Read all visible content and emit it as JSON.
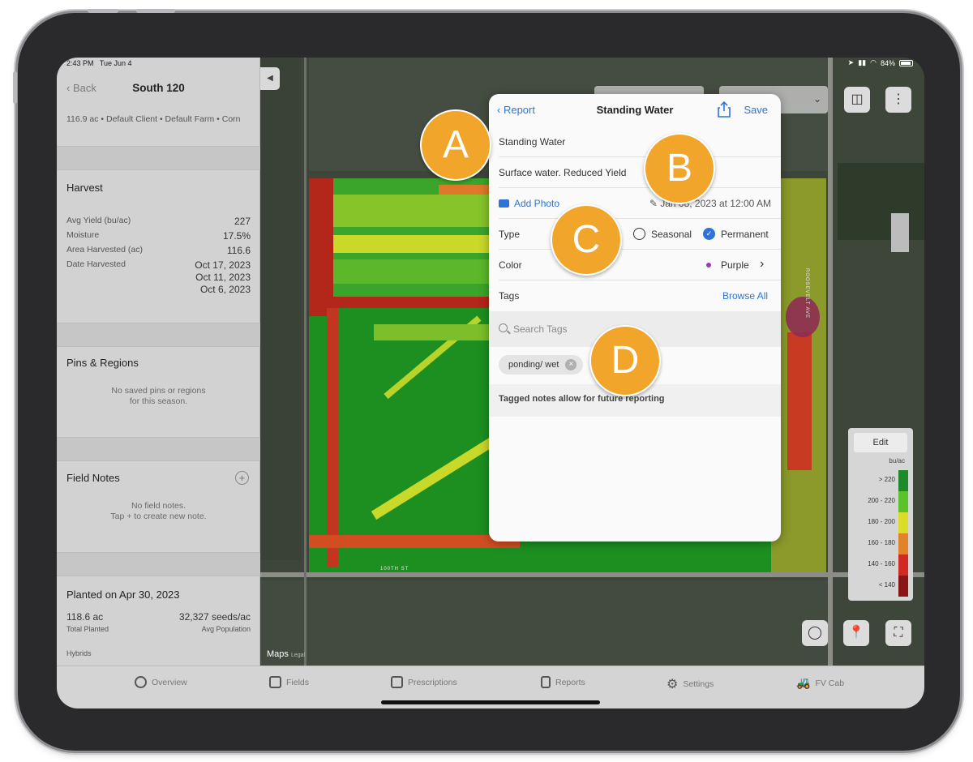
{
  "status": {
    "time": "2:43 PM",
    "date": "Tue Jun 4",
    "battery": "84%"
  },
  "sidebar": {
    "back_label": "Back",
    "title": "South 120",
    "subtitle": "116.9 ac • Default Client • Default Farm • Corn",
    "harvest": {
      "title": "Harvest",
      "rows": [
        {
          "label": "Avg Yield (bu/ac)",
          "value": "227"
        },
        {
          "label": "Moisture",
          "value": "17.5%"
        },
        {
          "label": "Area Harvested (ac)",
          "value": "116.6"
        },
        {
          "label": "Date Harvested",
          "value": "Oct 17, 2023"
        }
      ],
      "extra_dates": [
        "Oct 11, 2023",
        "Oct 6, 2023"
      ]
    },
    "pins": {
      "title": "Pins & Regions",
      "empty_line1": "No saved pins or regions",
      "empty_line2": "for this season."
    },
    "notes": {
      "title": "Field Notes",
      "empty_line1": "No field notes.",
      "empty_line2": "Tap + to create new note."
    },
    "planted": {
      "title": "Planted on Apr 30, 2023",
      "area_value": "118.6 ac",
      "area_label": "Total Planted",
      "pop_value": "32,327 seeds/ac",
      "pop_label": "Avg Population",
      "hybrids_label": "Hybrids"
    }
  },
  "map": {
    "road_bottom": "100TH ST",
    "road_right": "ROOSEVELT AVE",
    "maps_logo": "Maps",
    "legal": "Legal"
  },
  "legend": {
    "edit_label": "Edit",
    "unit": "bu/ac",
    "classes": [
      {
        "label": "> 220",
        "color": "#1e8a2a"
      },
      {
        "label": "200 - 220",
        "color": "#5cc22a"
      },
      {
        "label": "180 - 200",
        "color": "#d9dd2a"
      },
      {
        "label": "160 - 180",
        "color": "#e2832c"
      },
      {
        "label": "140 - 160",
        "color": "#d12a22"
      },
      {
        "label": "< 140",
        "color": "#8b1416"
      }
    ]
  },
  "popover": {
    "back_label": "Report",
    "title": "Standing Water",
    "save_label": "Save",
    "name_value": "Standing Water",
    "description_value": "Surface water. Reduced Yield",
    "add_photo_label": "Add Photo",
    "date_value": "Jan 08, 2023 at 12:00 AM",
    "type_label": "Type",
    "type_options": [
      "Seasonal",
      "Permanent"
    ],
    "type_selected": "Permanent",
    "color_label": "Color",
    "color_value": "Purple",
    "color_swatch": "#9b3bb5",
    "tags_label": "Tags",
    "browse_label": "Browse All",
    "search_placeholder": "Search Tags",
    "tag_chip": "ponding/ wet",
    "hint": "Tagged notes allow for future reporting"
  },
  "callouts": [
    "A",
    "B",
    "C",
    "D"
  ],
  "tabs": [
    {
      "label": "Overview",
      "icon": "overview-icon"
    },
    {
      "label": "Fields",
      "icon": "fields-icon"
    },
    {
      "label": "Prescriptions",
      "icon": "prescriptions-icon"
    },
    {
      "label": "Reports",
      "icon": "reports-icon"
    },
    {
      "label": "Settings",
      "icon": "gear-icon"
    },
    {
      "label": "FV Cab",
      "icon": "tractor-icon"
    }
  ],
  "colors": {
    "accent": "#2f73d8",
    "callout": "#f2a52b",
    "field_green": "#1d8f21"
  }
}
